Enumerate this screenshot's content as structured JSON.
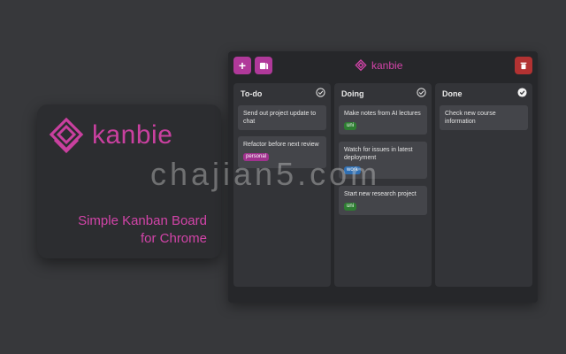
{
  "promo": {
    "brand": "kanbie",
    "tagline_line1": "Simple Kanban Board",
    "tagline_line2": "for Chrome"
  },
  "watermark": "chajian5.com",
  "header": {
    "add_label": "+",
    "brand": "kanbie"
  },
  "columns": [
    {
      "title": "To-do",
      "cards": [
        {
          "text": "Send out project update to chat",
          "tag": ""
        },
        {
          "text": "Refactor before next review",
          "tag": "personal"
        }
      ]
    },
    {
      "title": "Doing",
      "cards": [
        {
          "text": "Make notes from AI lectures",
          "tag": "uni"
        },
        {
          "text": "Watch for issues in latest deployment",
          "tag": "work"
        },
        {
          "text": "Start new research project",
          "tag": "uni"
        }
      ]
    },
    {
      "title": "Done",
      "cards": [
        {
          "text": "Check new course information",
          "tag": ""
        }
      ]
    }
  ],
  "colors": {
    "accent": "#d244a8",
    "button": "#b0399a",
    "danger": "#b23232",
    "tag_uni": "#2e7d32",
    "tag_personal": "#a0328e",
    "tag_work": "#2f6fb3"
  }
}
